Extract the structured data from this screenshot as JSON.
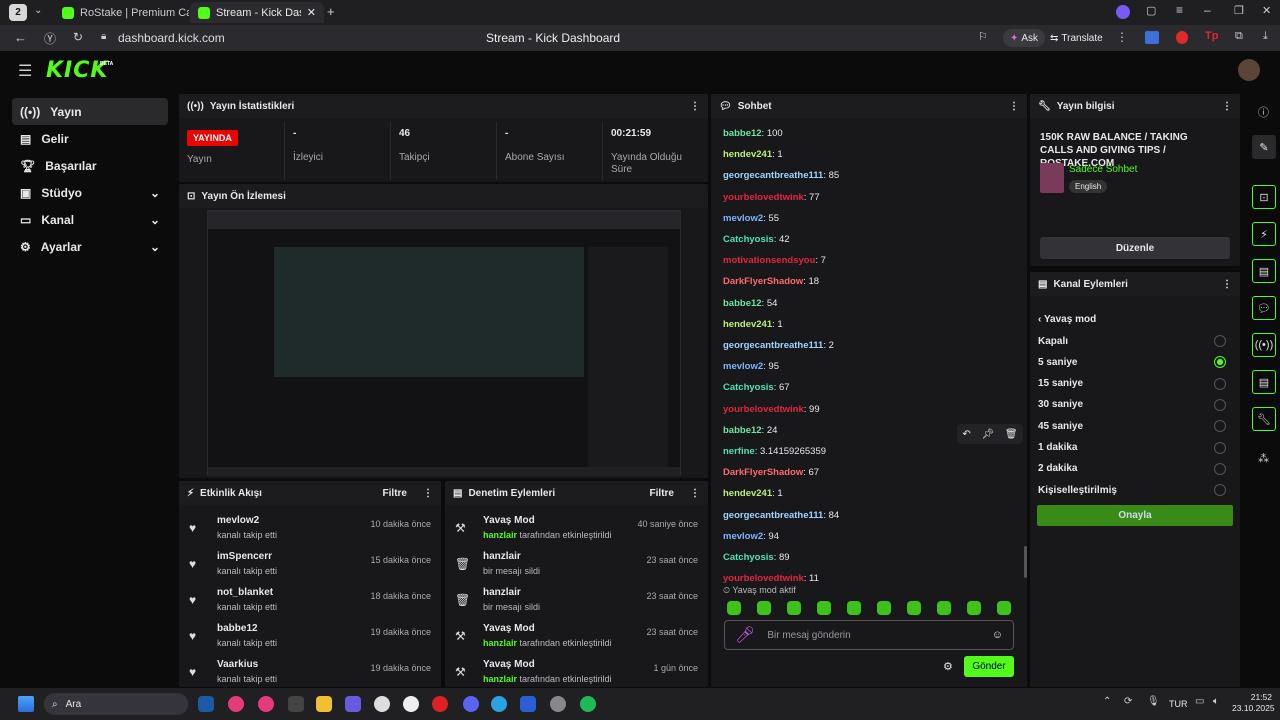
{
  "browser": {
    "tab_count": "2",
    "tabs": [
      {
        "label": "RoStake | Premium Case O"
      },
      {
        "label": "Stream - Kick Dashboard"
      }
    ],
    "url": "dashboard.kick.com",
    "window_title": "Stream - Kick Dashboard",
    "ask_label": "Ask",
    "translate_label": "Translate"
  },
  "header": {
    "logo": "KICK",
    "beta": "BETA"
  },
  "sidebar": {
    "items": [
      {
        "label": "Yayın",
        "icon": "broadcast-icon"
      },
      {
        "label": "Gelir",
        "icon": "money-icon"
      },
      {
        "label": "Başarılar",
        "icon": "trophy-icon"
      },
      {
        "label": "Stüdyo",
        "icon": "studio-icon"
      },
      {
        "label": "Kanal",
        "icon": "channel-icon"
      },
      {
        "label": "Ayarlar",
        "icon": "gear-icon"
      }
    ]
  },
  "stats": {
    "title": "Yayın İstatistikleri",
    "live_badge": "YAYINDA",
    "items": [
      {
        "value": "",
        "label": "Yayın"
      },
      {
        "value": "-",
        "label": "İzleyici"
      },
      {
        "value": "46",
        "label": "Takipçi"
      },
      {
        "value": "-",
        "label": "Abone Sayısı"
      },
      {
        "value": "00:21:59",
        "label": "Yayında Olduğu Süre"
      }
    ]
  },
  "preview": {
    "title": "Yayın Ön İzlemesi"
  },
  "activity": {
    "title": "Etkinlik Akışı",
    "filter": "Filtre",
    "rows": [
      {
        "name": "mevlow2",
        "sub": "kanalı takip etti",
        "time": "10 dakika önce"
      },
      {
        "name": "imSpencerr",
        "sub": "kanalı takip etti",
        "time": "15 dakika önce"
      },
      {
        "name": "not_blanket",
        "sub": "kanalı takip etti",
        "time": "18 dakika önce"
      },
      {
        "name": "babbe12",
        "sub": "kanalı takip etti",
        "time": "19 dakika önce"
      },
      {
        "name": "Vaarkius",
        "sub": "kanalı takip etti",
        "time": "19 dakika önce"
      }
    ]
  },
  "moderation": {
    "title": "Denetim Eylemleri",
    "filter": "Filtre",
    "rows": [
      {
        "name": "Yavaş Mod",
        "user": "hanzlair",
        "sub": " tarafından etkinleştirildi",
        "time": "40 saniye önce",
        "icon": "hammer-icon"
      },
      {
        "name": "hanzlair",
        "user": "",
        "sub": "bir mesajı sildi",
        "time": "23 saat önce",
        "icon": "trash-icon"
      },
      {
        "name": "hanzlair",
        "user": "",
        "sub": "bir mesajı sildi",
        "time": "23 saat önce",
        "icon": "trash-icon"
      },
      {
        "name": "Yavaş Mod",
        "user": "hanzlair",
        "sub": " tarafından etkinleştirildi",
        "time": "23 saat önce",
        "icon": "hammer-icon"
      },
      {
        "name": "Yavaş Mod",
        "user": "hanzlair",
        "sub": " tarafından etkinleştirildi",
        "time": "1 gün önce",
        "icon": "hammer-icon"
      }
    ]
  },
  "chat": {
    "title": "Sohbet",
    "messages": [
      {
        "user": "babbe12",
        "text": ": 100",
        "color": "#6ee6a0"
      },
      {
        "user": "hendev241",
        "text": ": 1",
        "color": "#b8f27a"
      },
      {
        "user": "georgecantbreathe111",
        "text": ": 85",
        "color": "#9fd4ff"
      },
      {
        "user": "yourbelovedtwink",
        "text": ": 77",
        "color": "#e3263c"
      },
      {
        "user": "mevlow2",
        "text": ": 55",
        "color": "#7fb3ff"
      },
      {
        "user": "Catchyosis",
        "text": ": 42",
        "color": "#4fe3b0"
      },
      {
        "user": "motivationsendsyou",
        "text": ": 7",
        "color": "#e3263c"
      },
      {
        "user": "DarkFlyerShadow",
        "text": ": 18",
        "color": "#ff6a6a"
      },
      {
        "user": "babbe12",
        "text": ": 54",
        "color": "#6ee6a0"
      },
      {
        "user": "hendev241",
        "text": ": 1",
        "color": "#b8f27a"
      },
      {
        "user": "georgecantbreathe111",
        "text": ": 2",
        "color": "#9fd4ff"
      },
      {
        "user": "mevlow2",
        "text": ": 95",
        "color": "#7fb3ff"
      },
      {
        "user": "Catchyosis",
        "text": ": 67",
        "color": "#4fe3b0"
      },
      {
        "user": "yourbelovedtwink",
        "text": ": 99",
        "color": "#e3263c"
      },
      {
        "user": "babbe12",
        "text": ": 24",
        "color": "#6ee6a0"
      },
      {
        "user": "nerfine",
        "text": ": 3.14159265359",
        "color": "#4fe3b0"
      },
      {
        "user": "DarkFlyerShadow",
        "text": ": 67",
        "color": "#ff6a6a"
      },
      {
        "user": "hendev241",
        "text": ": 1",
        "color": "#b8f27a"
      },
      {
        "user": "georgecantbreathe111",
        "text": ": 84",
        "color": "#9fd4ff"
      },
      {
        "user": "mevlow2",
        "text": ": 94",
        "color": "#7fb3ff"
      },
      {
        "user": "Catchyosis",
        "text": ": 89",
        "color": "#4fe3b0"
      },
      {
        "user": "yourbelovedtwink",
        "text": ": 11",
        "color": "#e3263c"
      }
    ],
    "slow_mode_notice": "Yavaş mod aktif",
    "input_placeholder": "Bir mesaj gönderin",
    "send_label": "Gönder"
  },
  "stream_info": {
    "title": "Yayın bilgisi",
    "stream_title": "150K RAW BALANCE / TAKING CALLS AND GIVING TIPS / ROSTAKE.COM",
    "category": "Sadece Sohbet",
    "tag": "English",
    "edit_label": "Düzenle"
  },
  "channel_actions": {
    "title": "Kanal Eylemleri",
    "subtitle": "Yavaş mod",
    "options": [
      {
        "label": "Kapalı",
        "selected": false
      },
      {
        "label": "5 saniye",
        "selected": true
      },
      {
        "label": "15 saniye",
        "selected": false
      },
      {
        "label": "30 saniye",
        "selected": false
      },
      {
        "label": "45 saniye",
        "selected": false
      },
      {
        "label": "1 dakika",
        "selected": false
      },
      {
        "label": "2 dakika",
        "selected": false
      },
      {
        "label": "Kişiselleştirilmiş",
        "selected": false
      }
    ],
    "confirm_label": "Onayla"
  },
  "taskbar": {
    "search_label": "Ara",
    "lang": "TUR",
    "time": "21:52",
    "date": "23.10.2025"
  },
  "colors": {
    "accent": "#53fc18",
    "live": "#eb0400",
    "panel": "#18181b"
  }
}
